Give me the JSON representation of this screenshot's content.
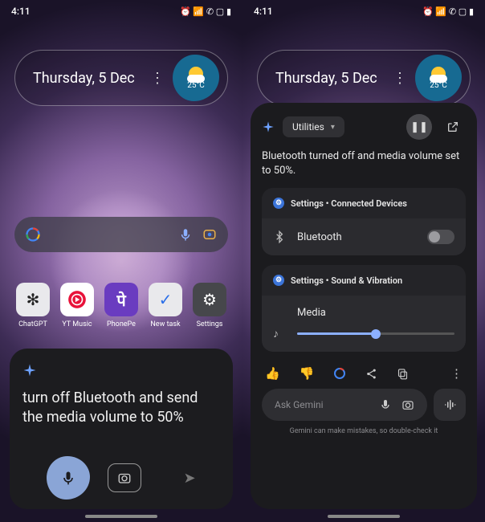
{
  "statusbar": {
    "time": "4:11",
    "icons": [
      "alarm",
      "wifi-calling",
      "vibrate",
      "network",
      "signal",
      "battery"
    ]
  },
  "date_widget": {
    "date": "Thursday, 5 Dec",
    "temp": "25°C"
  },
  "apps": [
    {
      "name": "ChatGPT",
      "bg": "#e9e9ec",
      "fg": "#222"
    },
    {
      "name": "YT Music",
      "bg": "#fff",
      "fg": "#e8133a"
    },
    {
      "name": "PhonePe",
      "bg": "#6a3cc0",
      "fg": "#fff"
    },
    {
      "name": "New task",
      "bg": "#e9e9ec",
      "fg": "#2b6fe8"
    },
    {
      "name": "Settings",
      "bg": "#46474b",
      "fg": "#fff"
    }
  ],
  "gemini_prompt": {
    "text": "turn off Bluetooth and send the media volume to 50%"
  },
  "gemini_response": {
    "chip": "Utilities",
    "text": "Bluetooth turned off and media volume set to 50%.",
    "card1_title": "Settings • Connected Devices",
    "bluetooth_label": "Bluetooth",
    "bluetooth_on": false,
    "card2_title": "Settings • Sound & Vibration",
    "media_label": "Media",
    "media_value": 50,
    "ask_placeholder": "Ask Gemini",
    "disclaimer": "Gemini can make mistakes, so double-check it"
  }
}
